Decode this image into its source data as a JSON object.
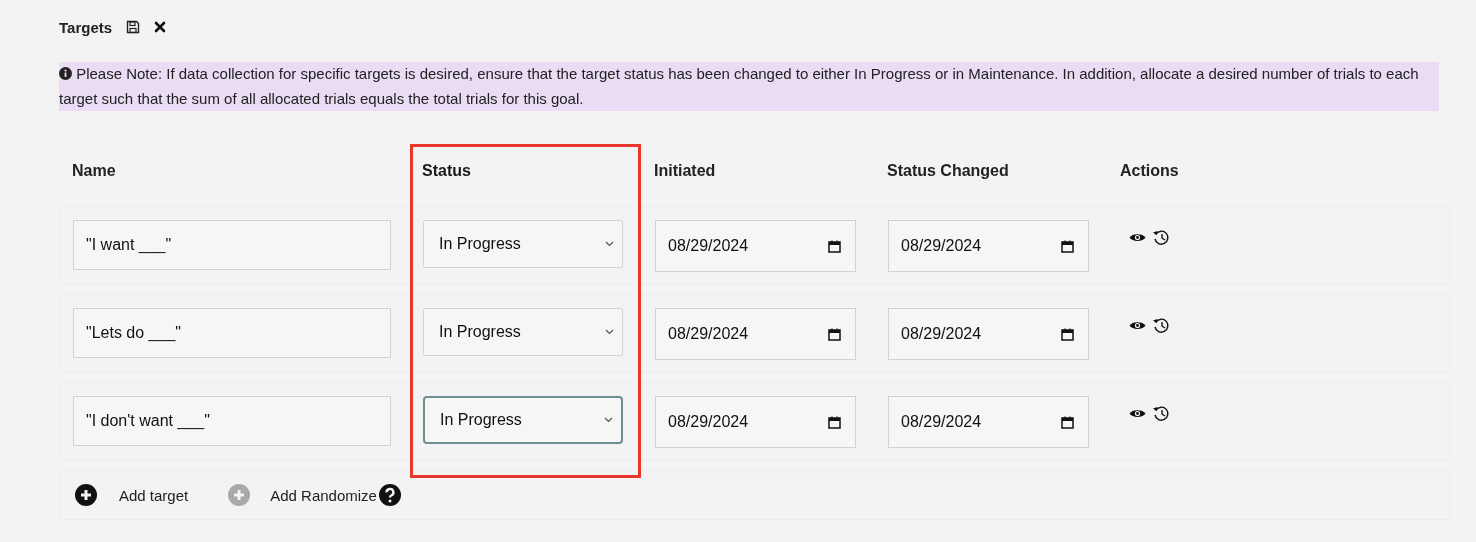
{
  "section": {
    "title": "Targets"
  },
  "note": {
    "text": "Please Note: If data collection for specific targets is desired, ensure that the target status has been changed to either In Progress or in Maintenance. In addition, allocate a desired number of trials to each target such that the sum of all allocated trials equals the total trials for this goal."
  },
  "table": {
    "columns": [
      {
        "label": "Name",
        "highlighted": false
      },
      {
        "label": "Status",
        "highlighted": true
      },
      {
        "label": "Initiated",
        "highlighted": false
      },
      {
        "label": "Status Changed",
        "highlighted": false
      },
      {
        "label": "Actions",
        "highlighted": false
      }
    ],
    "rows": [
      {
        "name": "\"I want ___\"",
        "status": "In Progress",
        "status_focused": false,
        "initiated": "08/29/2024",
        "status_changed": "08/29/2024"
      },
      {
        "name": "\"Lets do ___\"",
        "status": "In Progress",
        "status_focused": false,
        "initiated": "08/29/2024",
        "status_changed": "08/29/2024"
      },
      {
        "name": "\"I don't want ___\"",
        "status": "In Progress",
        "status_focused": true,
        "initiated": "08/29/2024",
        "status_changed": "08/29/2024"
      }
    ]
  },
  "footer_actions": [
    {
      "label": "Add target",
      "disabled": false
    },
    {
      "label": "Add Randomize",
      "disabled": true,
      "help": true
    }
  ]
}
